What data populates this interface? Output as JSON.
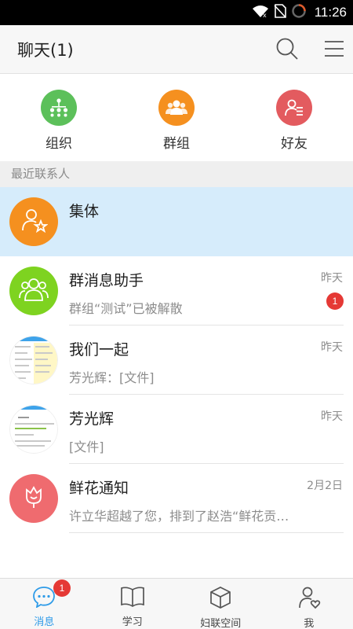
{
  "status_bar": {
    "time": "11:26"
  },
  "header": {
    "title": "聊天(1)"
  },
  "categories": [
    {
      "label": "组织",
      "color": "#5cc05a",
      "icon": "org-chart-icon"
    },
    {
      "label": "群组",
      "color": "#f5901f",
      "icon": "group-icon"
    },
    {
      "label": "好友",
      "color": "#e35b5f",
      "icon": "friend-icon"
    }
  ],
  "section": {
    "recent_contacts": "最近联系人"
  },
  "chats": [
    {
      "name": "集体",
      "message": "",
      "time": "",
      "badge": "",
      "avatar_color": "#f5901f",
      "highlighted": true
    },
    {
      "name": "群消息助手",
      "message": "群组“测试”已被解散",
      "time": "昨天",
      "badge": "1",
      "avatar_color": "#7ed320"
    },
    {
      "name": "我们一起",
      "message": "芳光辉：[文件]",
      "time": "昨天",
      "badge": ""
    },
    {
      "name": "芳光辉",
      "message": "[文件]",
      "time": "昨天",
      "badge": ""
    },
    {
      "name": "鲜花通知",
      "message": "许立华超越了您，排到了赵浩“鲜花贡…",
      "time": "2月2日",
      "badge": "",
      "avatar_color": "#ef6b6f"
    }
  ],
  "bottom_nav": [
    {
      "label": "消息",
      "badge": "1",
      "active": true
    },
    {
      "label": "学习"
    },
    {
      "label": "妇联空间"
    },
    {
      "label": "我"
    }
  ],
  "colors": {
    "accent": "#2e9be8",
    "badge": "#e53935",
    "highlight_row": "#d6ecfb"
  }
}
